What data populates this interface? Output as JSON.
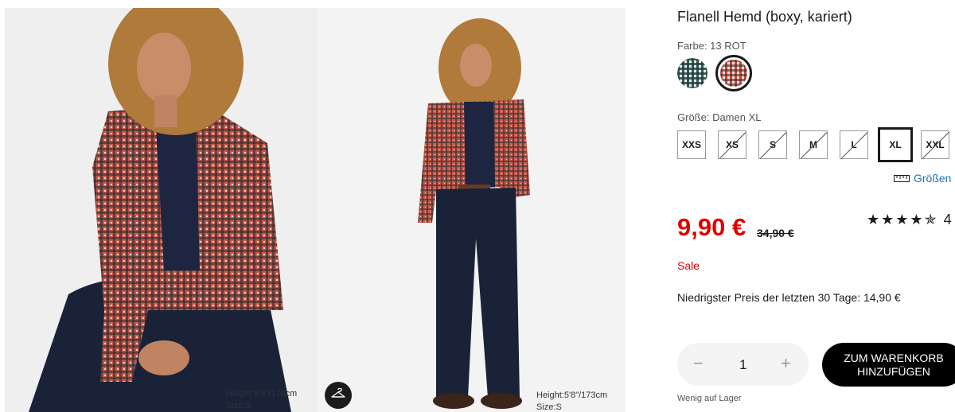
{
  "gallery": {
    "left_image_alt": "Model sitzend im karierten Flanellhemd",
    "right_image_alt": "Model stehend im karierten Flanellhemd",
    "left_caption": {
      "height": "Height:5'8\"/173cm",
      "size": "Size:S"
    },
    "right_caption": {
      "height": "Height:5'8\"/173cm",
      "size": "Size:S"
    },
    "hanger_icon": "hanger-icon"
  },
  "product": {
    "title": "Flanell Hemd (boxy, kariert)",
    "color_label": "Farbe: 13 ROT",
    "swatches": [
      {
        "name": "green-check",
        "color": "#2f5a55",
        "selected": false
      },
      {
        "name": "red-check",
        "color": "#c8443a",
        "selected": true
      }
    ],
    "size_label": "Größe: Damen XL",
    "sizes": [
      {
        "label": "XXS",
        "available": true,
        "selected": false
      },
      {
        "label": "XS",
        "available": false,
        "selected": false
      },
      {
        "label": "S",
        "available": false,
        "selected": false
      },
      {
        "label": "M",
        "available": false,
        "selected": false
      },
      {
        "label": "L",
        "available": false,
        "selected": false
      },
      {
        "label": "XL",
        "available": true,
        "selected": true
      },
      {
        "label": "XXL",
        "available": false,
        "selected": false
      }
    ],
    "size_guide": "Größen",
    "price": "9,90 €",
    "old_price": "34,90 €",
    "rating": "★★★★",
    "rating_half": "✯",
    "rating_value": "4",
    "sale_label": "Sale",
    "lowest_price": "Niedrigster Preis der letzten 30 Tage: 14,90 €",
    "quantity": "1",
    "qty_minus": "−",
    "qty_plus": "+",
    "cart_line1": "ZUM WARENKORB",
    "cart_line2": "HINZUFÜGEN",
    "stock": "Wenig auf Lager"
  },
  "colors": {
    "sale_red": "#e00000",
    "link_blue": "#1f6fbf",
    "button_black": "#000000"
  }
}
